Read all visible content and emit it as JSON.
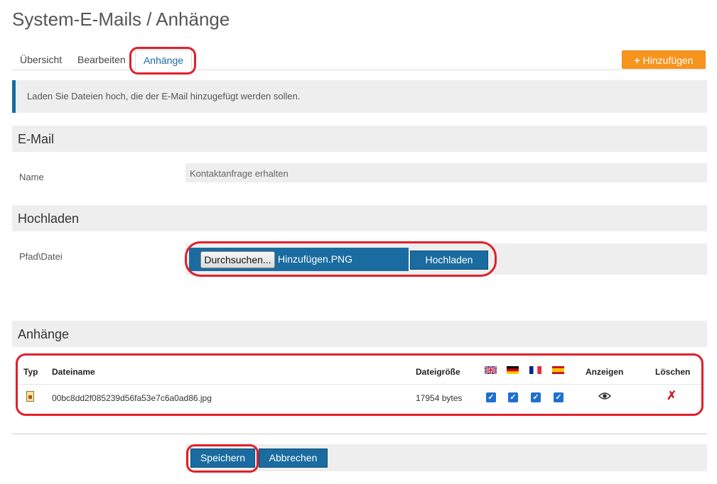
{
  "page": {
    "title": "System-E-Mails / Anhänge"
  },
  "tabs": [
    {
      "label": "Übersicht"
    },
    {
      "label": "Bearbeiten"
    },
    {
      "label": "Anhänge",
      "active": true
    }
  ],
  "toolbar": {
    "add_label": "Hinzufügen",
    "add_icon": "plus-icon",
    "add_color": "#f7941d"
  },
  "info": {
    "text": "Laden Sie Dateien hoch, die der E-Mail hinzugefügt werden sollen."
  },
  "email_section": {
    "heading": "E-Mail",
    "name_label": "Name",
    "name_value": "Kontaktanfrage erhalten"
  },
  "upload_section": {
    "heading": "Hochladen",
    "path_label": "Pfad\\Datei",
    "browse_label": "Durchsuchen...",
    "selected_file": "Hinzufügen.PNG",
    "upload_label": "Hochladen"
  },
  "attachments_section": {
    "heading": "Anhänge",
    "columns": {
      "type": "Typ",
      "filename": "Dateiname",
      "size": "Dateigröße",
      "flags": [
        "flag-uk-icon",
        "flag-de-icon",
        "flag-fr-icon",
        "flag-es-icon"
      ],
      "view": "Anzeigen",
      "delete": "Löschen"
    },
    "rows": [
      {
        "type_icon": "image-file-icon",
        "filename": "00bc8dd2f085239d56fa53e7c6a0ad86.jpg",
        "size": "17954 bytes",
        "languages": [
          true,
          true,
          true,
          true
        ],
        "view_icon": "eye-icon",
        "delete_icon": "delete-x-icon"
      }
    ]
  },
  "footer": {
    "save_label": "Speichern",
    "cancel_label": "Abbrechen"
  },
  "colors": {
    "primary": "#1a6ca0",
    "accent": "#f7941d",
    "highlight": "#e0202a"
  }
}
